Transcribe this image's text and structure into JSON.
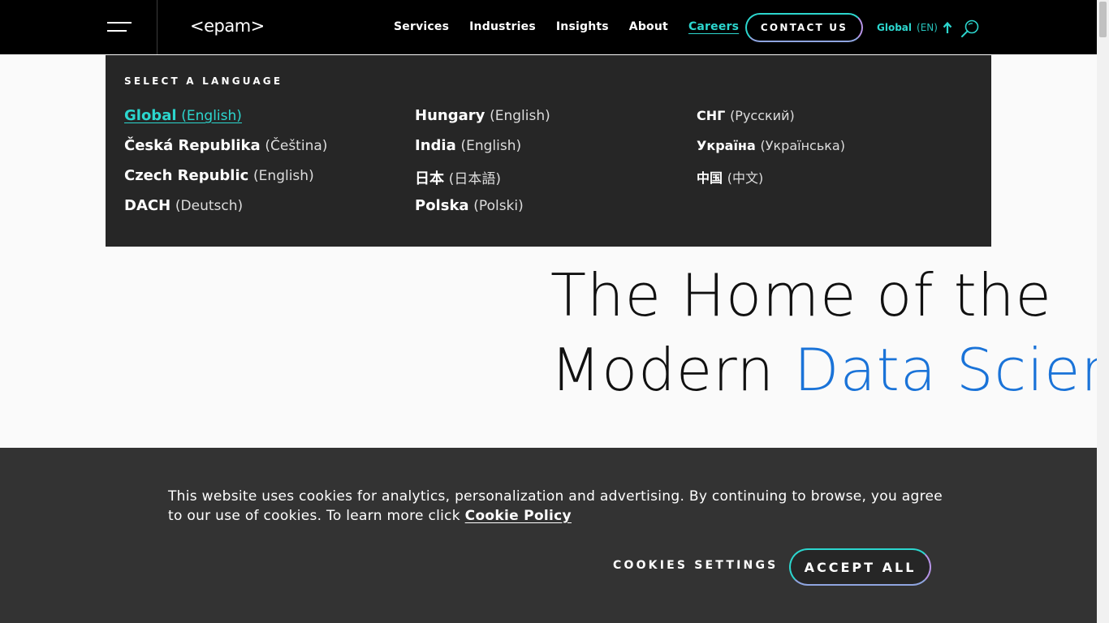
{
  "header": {
    "logo": "<epam>",
    "nav": [
      "Services",
      "Industries",
      "Insights",
      "About",
      "Careers"
    ],
    "contact_label": "CONTACT US",
    "language_current": "Global",
    "language_code": "(EN)"
  },
  "language_panel": {
    "title": "SELECT A LANGUAGE",
    "columns": [
      [
        {
          "region": "Global",
          "language": "(English)"
        },
        {
          "region": "Česká Republika",
          "language": "(Čeština)"
        },
        {
          "region": "Czech Republic",
          "language": "(English)"
        },
        {
          "region": "DACH",
          "language": "(Deutsch)"
        }
      ],
      [
        {
          "region": "Hungary",
          "language": "(English)"
        },
        {
          "region": "India",
          "language": "(English)"
        },
        {
          "region": "日本",
          "language": "(日本語)"
        },
        {
          "region": "Polska",
          "language": "(Polski)"
        }
      ],
      [
        {
          "region": "СНГ",
          "language": "(Русский)"
        },
        {
          "region": "Україна",
          "language": "(Українська)"
        },
        {
          "region": "中国",
          "language": "(中文)"
        }
      ]
    ]
  },
  "hero": {
    "line1": "The Home of the",
    "line2_plain": "Modern ",
    "line2_accent": "Data Science"
  },
  "cookie": {
    "text": "This website uses cookies for analytics, personalization and advertising. By continuing to browse, you agree to our use of cookies. To learn more click ",
    "link": "Cookie Policy",
    "settings_label": "COOKIES SETTINGS",
    "accept_label": "ACCEPT ALL"
  },
  "colors": {
    "accent_teal": "#2cd6ce",
    "accent_blue": "#1a73d8",
    "header_bg": "#000000",
    "panel_bg": "#262626",
    "cookie_bg": "#333333"
  }
}
